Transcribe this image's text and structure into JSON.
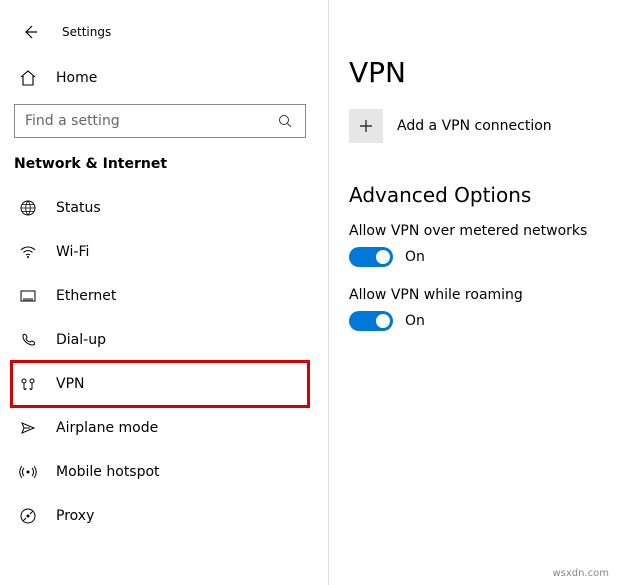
{
  "header": {
    "app_title": "Settings",
    "home_label": "Home",
    "search_placeholder": "Find a setting",
    "category": "Network & Internet"
  },
  "sidebar": {
    "items": [
      {
        "label": "Status",
        "icon": "status-icon",
        "selected": false
      },
      {
        "label": "Wi-Fi",
        "icon": "wifi-icon",
        "selected": false
      },
      {
        "label": "Ethernet",
        "icon": "ethernet-icon",
        "selected": false
      },
      {
        "label": "Dial-up",
        "icon": "dialup-icon",
        "selected": false
      },
      {
        "label": "VPN",
        "icon": "vpn-icon",
        "selected": true
      },
      {
        "label": "Airplane mode",
        "icon": "airplane-icon",
        "selected": false
      },
      {
        "label": "Mobile hotspot",
        "icon": "hotspot-icon",
        "selected": false
      },
      {
        "label": "Proxy",
        "icon": "proxy-icon",
        "selected": false
      }
    ]
  },
  "main": {
    "title": "VPN",
    "add_connection": "Add a VPN connection",
    "advanced_title": "Advanced Options",
    "settings": [
      {
        "label": "Allow VPN over metered networks",
        "state": "On",
        "on": true
      },
      {
        "label": "Allow VPN while roaming",
        "state": "On",
        "on": true
      }
    ]
  },
  "attribution": "wsxdn.com"
}
